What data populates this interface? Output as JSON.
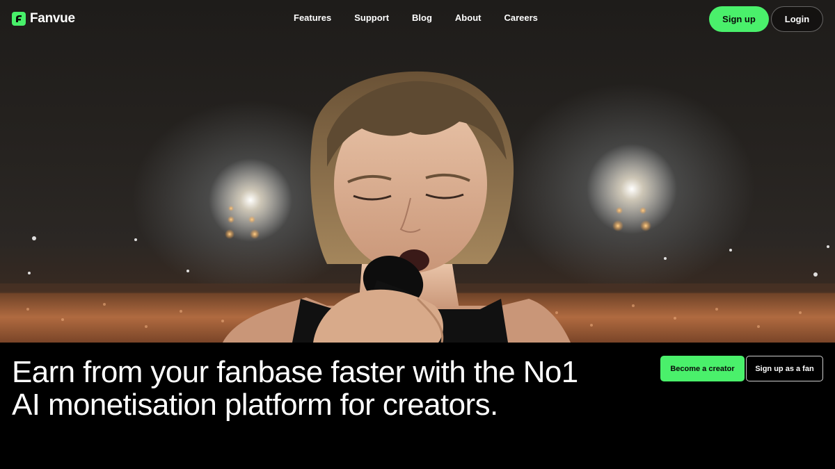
{
  "brand": {
    "name": "Fanvue",
    "accent_color": "#4af06b",
    "logo_icon": "fanvue-logo-icon"
  },
  "nav": {
    "links": [
      "Features",
      "Support",
      "Blog",
      "About",
      "Careers"
    ],
    "signup_label": "Sign up",
    "login_label": "Login"
  },
  "hero": {
    "image": "concert-singer-with-microphone",
    "headline": "Earn from your fanbase faster with the No1 AI monetisation platform for creators.",
    "primary_cta": "Become a creator",
    "secondary_cta": "Sign up as a fan"
  }
}
